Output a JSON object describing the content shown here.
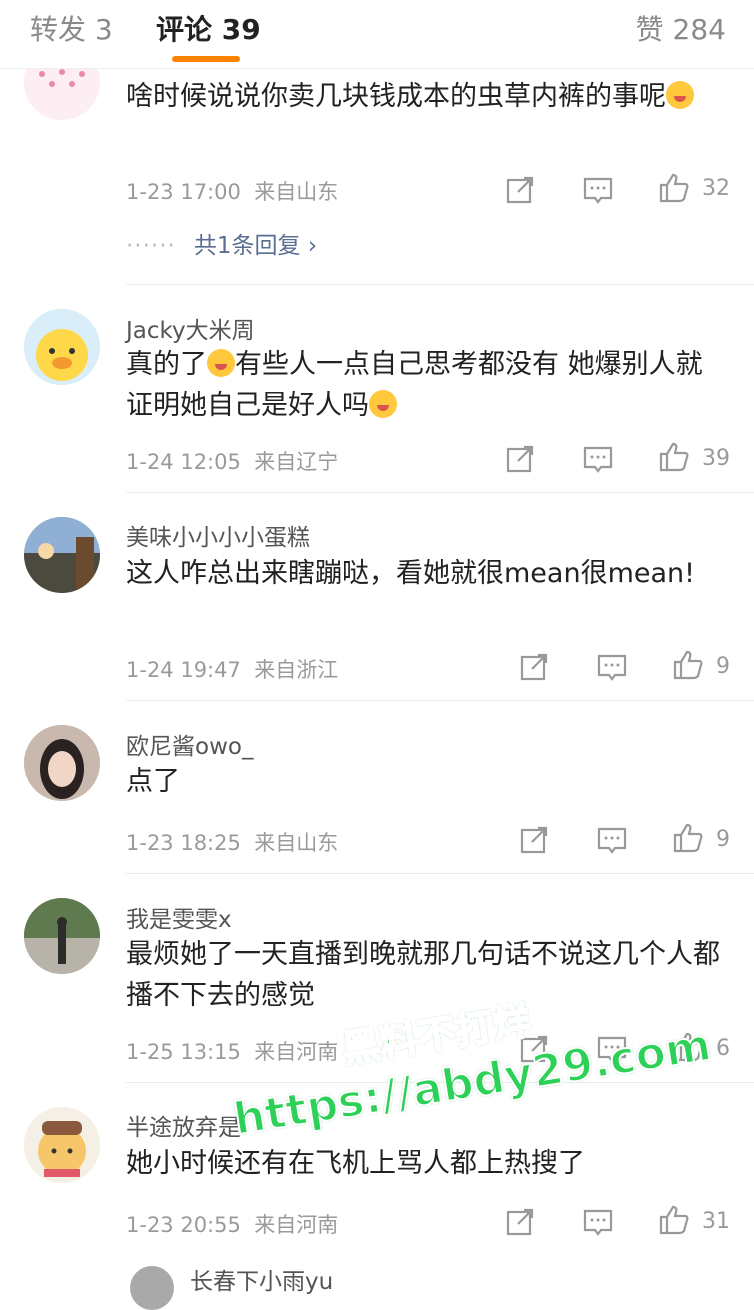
{
  "tabs": {
    "repost": "转发 3",
    "comments": "评论 39",
    "likes": "赞 284"
  },
  "comments": [
    {
      "username": "",
      "text_a": "啥时候说说你卖几块钱成本的虫草内裤的事呢",
      "text_b": "",
      "time": "1-23 17:00",
      "location": "来自山东",
      "likes": "32",
      "replies": "共1条回复"
    },
    {
      "username": "Jacky大米周",
      "text_a": "真的了",
      "text_b": "有些人一点自己思考都没有 她爆别人就证明她自己是好人吗",
      "time": "1-24 12:05",
      "location": "来自辽宁",
      "likes": "39"
    },
    {
      "username": "美味小小小小蛋糕",
      "text_a": "这人咋总出来瞎蹦哒，看她就很mean很mean!",
      "time": "1-24 19:47",
      "location": "来自浙江",
      "likes": "9"
    },
    {
      "username": "欧尼酱owo_",
      "text_a": "点了",
      "time": "1-23 18:25",
      "location": "来自山东",
      "likes": "9"
    },
    {
      "username": "我是雯雯x",
      "text_a": "最烦她了一天直播到晚就那几句话不说这几个人都播不下去的感觉",
      "time": "1-25 13:15",
      "location": "来自河南",
      "likes": "6"
    },
    {
      "username": "半途放弃是",
      "text_a": "她小时候还有在飞机上骂人都上热搜了",
      "time": "1-23 20:55",
      "location": "来自河南",
      "likes": "31"
    },
    {
      "username": "长春下小雨yu"
    }
  ],
  "watermark": {
    "line1": "黑料不打烊",
    "line2": "https://abdy29.com"
  },
  "colors": {
    "accent": "#ff8200",
    "reply_link": "#5b6e91",
    "watermark": "#2ed158"
  }
}
